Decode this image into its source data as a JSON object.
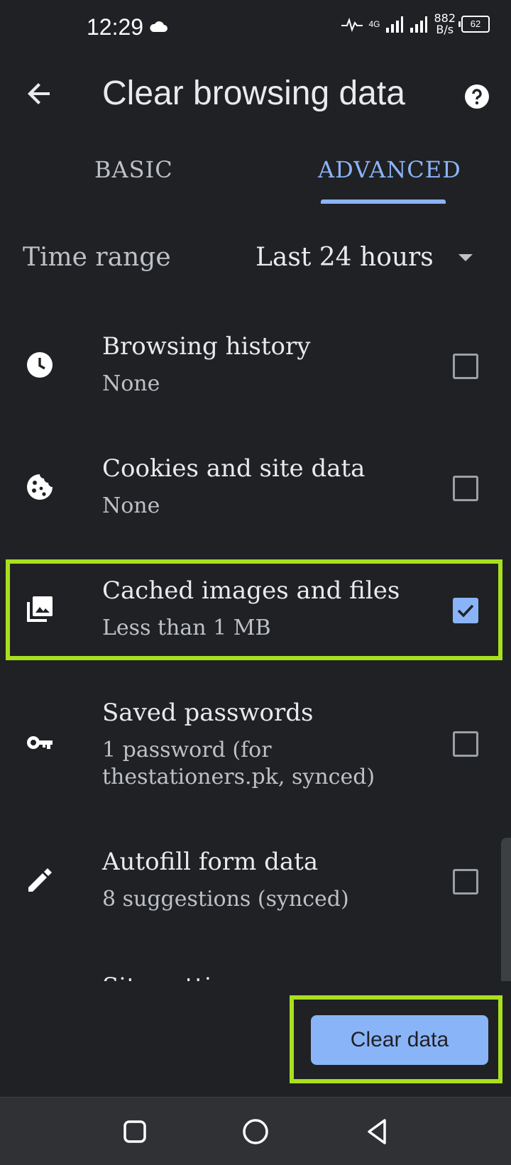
{
  "status_bar": {
    "time": "12:29",
    "network": "4G",
    "speed_value": "882",
    "speed_unit": "B/s",
    "battery": "62"
  },
  "header": {
    "title": "Clear browsing data",
    "back_icon": "arrow-back-icon",
    "help_icon": "help-icon"
  },
  "tabs": [
    {
      "label": "BASIC",
      "active": false
    },
    {
      "label": "ADVANCED",
      "active": true
    }
  ],
  "time_range": {
    "label": "Time range",
    "value": "Last 24 hours"
  },
  "items": [
    {
      "title": "Browsing history",
      "subtitle": "None",
      "icon": "clock-icon",
      "checked": false
    },
    {
      "title": "Cookies and site data",
      "subtitle": "None",
      "icon": "cookie-icon",
      "checked": false
    },
    {
      "title": "Cached images and files",
      "subtitle": "Less than 1 MB",
      "icon": "images-icon",
      "checked": true
    },
    {
      "title": "Saved passwords",
      "subtitle": "1 password (for thestationers.pk, synced)",
      "icon": "key-icon",
      "checked": false
    },
    {
      "title": "Autofill form data",
      "subtitle": "8 suggestions (synced)",
      "icon": "pencil-icon",
      "checked": false
    },
    {
      "title": "Site settings",
      "subtitle": "",
      "icon": "",
      "checked": false
    }
  ],
  "clear_button": "Clear data",
  "colors": {
    "background": "#202124",
    "accent": "#8ab4f8",
    "highlight": "#a8e01e"
  }
}
